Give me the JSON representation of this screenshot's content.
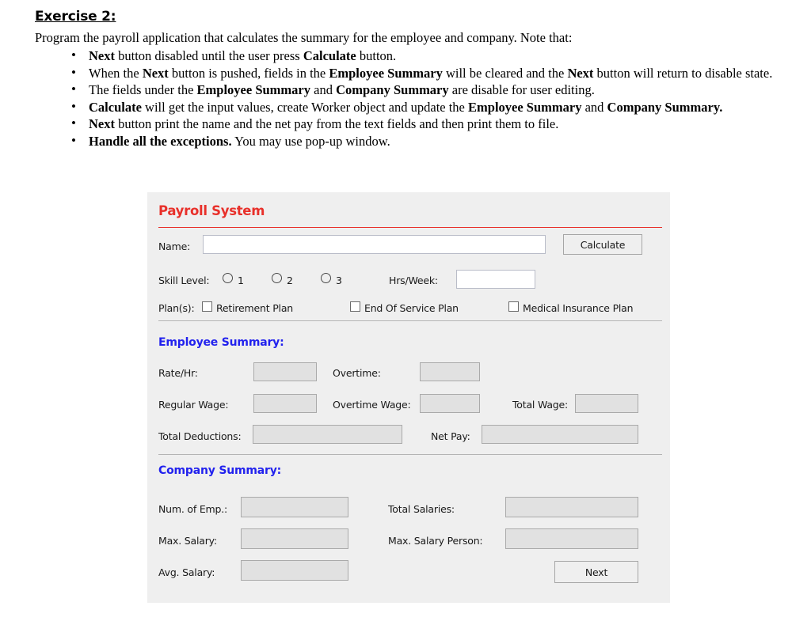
{
  "document": {
    "exercise_title": "Exercise 2:",
    "intro": "Program the payroll application that calculates the summary for the employee and company. Note that:",
    "bullets": [
      [
        {
          "t": "Next",
          "b": true
        },
        {
          "t": " button disabled until the user press ",
          "b": false
        },
        {
          "t": "Calculate",
          "b": true
        },
        {
          "t": " button.",
          "b": false
        }
      ],
      [
        {
          "t": "When the ",
          "b": false
        },
        {
          "t": "Next",
          "b": true
        },
        {
          "t": " button is pushed, fields in the ",
          "b": false
        },
        {
          "t": "Employee Summary",
          "b": true
        },
        {
          "t": " will be cleared and the ",
          "b": false
        },
        {
          "t": "Next",
          "b": true
        },
        {
          "t": " button will return to disable state.",
          "b": false
        }
      ],
      [
        {
          "t": "The fields under the ",
          "b": false
        },
        {
          "t": "Employee Summary",
          "b": true
        },
        {
          "t": " and ",
          "b": false
        },
        {
          "t": "Company Summary",
          "b": true
        },
        {
          "t": " are disable for user editing.",
          "b": false
        }
      ],
      [
        {
          "t": "Calculate",
          "b": true
        },
        {
          "t": " will get the input values, create Worker object and update the ",
          "b": false
        },
        {
          "t": "Employee Summary",
          "b": true
        },
        {
          "t": " and ",
          "b": false
        },
        {
          "t": "Company Summary.",
          "b": true
        }
      ],
      [
        {
          "t": "Next",
          "b": true
        },
        {
          "t": " button print the name and the net pay from the text fields and then print them to file.",
          "b": false
        }
      ],
      [
        {
          "t": "Handle all the exceptions.",
          "b": true
        },
        {
          "t": " You may use pop-up window.",
          "b": false
        }
      ]
    ]
  },
  "app": {
    "title": "Payroll System",
    "title_color": "#e8302a",
    "section_color": "#2222ee",
    "panel_bg": "#efefef",
    "input_row": {
      "name_label": "Name:",
      "name_value": "",
      "calculate_button": "Calculate",
      "skill_label": "Skill Level:",
      "skill_options": [
        "1",
        "2",
        "3"
      ],
      "skill_selected": "",
      "hrs_label": "Hrs/Week:",
      "hrs_value": "",
      "plans_label": "Plan(s):",
      "plans": [
        {
          "label": "Retirement Plan",
          "checked": false
        },
        {
          "label": "End Of Service Plan",
          "checked": false
        },
        {
          "label": "Medical Insurance Plan",
          "checked": false
        }
      ]
    },
    "employee_summary": {
      "heading": "Employee Summary:",
      "fields": [
        {
          "label": "Rate/Hr:",
          "value": ""
        },
        {
          "label": "Overtime:",
          "value": ""
        },
        {
          "label": "Regular Wage:",
          "value": ""
        },
        {
          "label": "Overtime Wage:",
          "value": ""
        },
        {
          "label": "Total Wage:",
          "value": ""
        },
        {
          "label": "Total Deductions:",
          "value": ""
        },
        {
          "label": "Net Pay:",
          "value": ""
        }
      ]
    },
    "company_summary": {
      "heading": "Company Summary:",
      "fields": [
        {
          "label": "Num. of Emp.:",
          "value": ""
        },
        {
          "label": "Total Salaries:",
          "value": ""
        },
        {
          "label": "Max. Salary:",
          "value": ""
        },
        {
          "label": "Max. Salary Person:",
          "value": ""
        },
        {
          "label": "Avg. Salary:",
          "value": ""
        }
      ],
      "next_button": "Next"
    }
  }
}
